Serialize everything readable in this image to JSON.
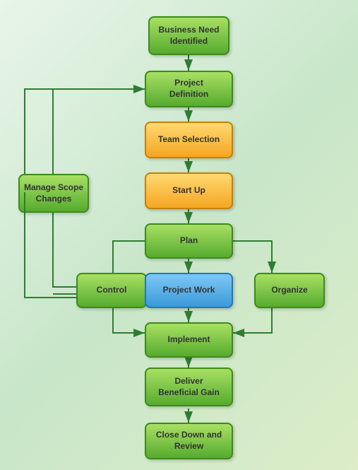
{
  "nodes": {
    "business_need": {
      "label": "Business Need\nIdentified"
    },
    "project_definition": {
      "label": "Project\nDefinition"
    },
    "team_selection": {
      "label": "Team Selection"
    },
    "start_up": {
      "label": "Start Up"
    },
    "plan": {
      "label": "Plan"
    },
    "control": {
      "label": "Control"
    },
    "project_work": {
      "label": "Project Work"
    },
    "organize": {
      "label": "Organize"
    },
    "implement": {
      "label": "Implement"
    },
    "deliver": {
      "label": "Deliver\nBeneficial Gain"
    },
    "close_down": {
      "label": "Close Down and\nReview"
    },
    "manage_scope": {
      "label": "Manage Scope\nChanges"
    }
  }
}
